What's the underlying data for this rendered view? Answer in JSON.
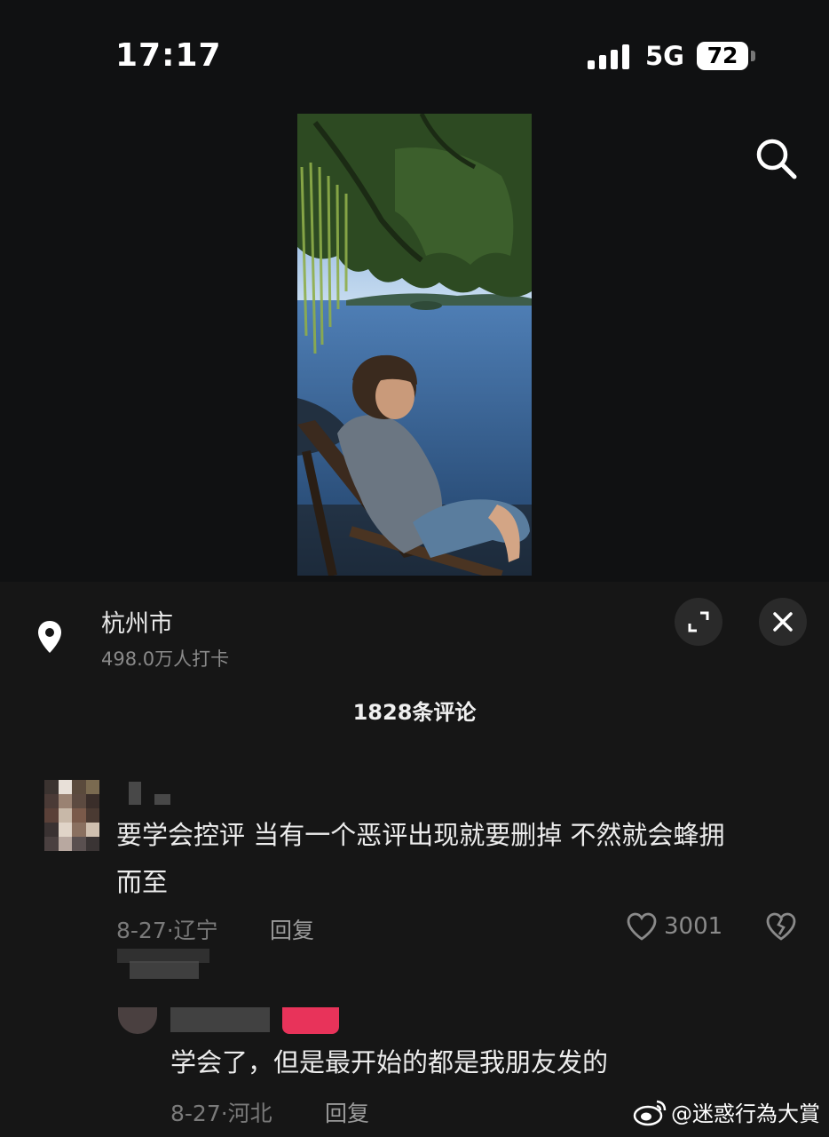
{
  "status_bar": {
    "time": "17:17",
    "network": "5G",
    "battery": "72"
  },
  "location": {
    "name": "杭州市",
    "checkins": "498.0万人打卡"
  },
  "comments_header": {
    "count_text": "1828条评论"
  },
  "comments": [
    {
      "text_line1": "要学会控评 当有一个恶评出现就要删掉 不然就会蜂拥",
      "text_line2": "而至",
      "meta": "8-27·辽宁",
      "reply_label": "回复",
      "likes": "3001"
    }
  ],
  "replies": [
    {
      "text": "学会了，但是最开始的都是我朋友发的",
      "meta": "8-27·河北",
      "reply_label": "回复"
    }
  ],
  "watermark": {
    "text": "@迷惑行為大賞"
  }
}
